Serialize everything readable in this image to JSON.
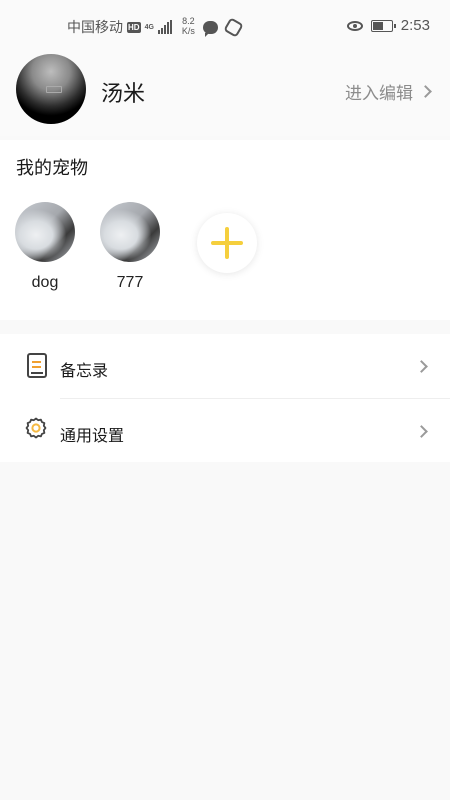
{
  "status_bar": {
    "carrier": "中国移动",
    "hd": "HD",
    "network": "4G",
    "speed_value": "8.2",
    "speed_unit": "K/s",
    "time": "2:53",
    "battery_level": 0.55,
    "icons": [
      "signal-icon",
      "message-icon",
      "app-icon",
      "eye-icon",
      "battery-icon"
    ]
  },
  "profile": {
    "username": "汤米",
    "edit_label": "进入编辑"
  },
  "pets": {
    "title": "我的宠物",
    "items": [
      {
        "name": "dog"
      },
      {
        "name": "777"
      }
    ],
    "add_icon": "plus-icon"
  },
  "menu": {
    "items": [
      {
        "label": "备忘录",
        "icon": "memo-icon"
      },
      {
        "label": "通用设置",
        "icon": "settings-gear-icon"
      }
    ]
  },
  "colors": {
    "accent_yellow": "#f5cf3d",
    "memo_lines": "#f0a030",
    "gear_center": "#f5b942",
    "secondary_text": "#8c8c8c",
    "background": "#f9f9f9"
  }
}
